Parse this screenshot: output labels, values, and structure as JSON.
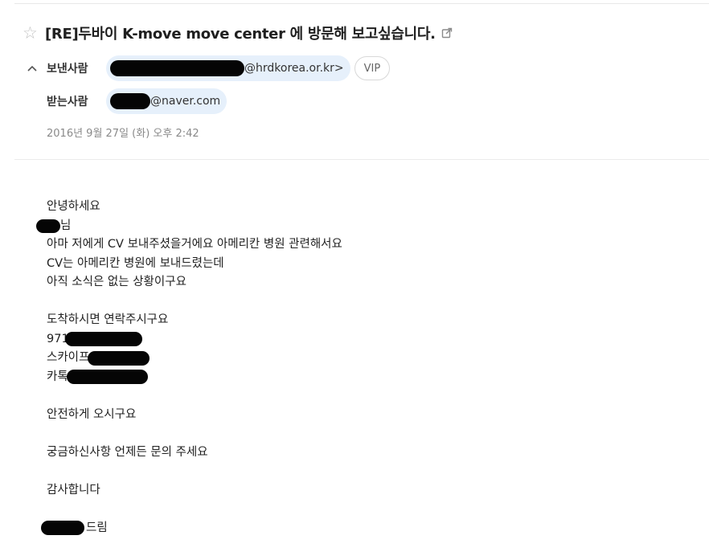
{
  "email": {
    "subject": "[RE]두바이 K-move move center 에 방문해 보고싶습니다.",
    "from_label": "보낸사람",
    "from_domain": "@hrdkorea.or.kr>",
    "vip_label": "VIP",
    "to_label": "받는사람",
    "to_domain": "@naver.com",
    "date": "2016년 9월 27일 (화) 오후 2:42"
  },
  "body": {
    "greeting": "안녕하세요",
    "name_suffix": "님",
    "line1": "아마 저에게 CV 보내주셨을거에요 아메리칸 병원 관련해서요",
    "line2": "CV는 아메리칸 병원에 보내드렸는데",
    "line3": "아직 소식은 없는 상황이구요",
    "line4": "도착하시면 연락주시구요",
    "phone_prefix": "971",
    "skype_label": "스카이프",
    "kakao_label": "카톡",
    "line5": "안전하게 오시구요",
    "line6": "궁금하신사항 언제든 문의 주세요",
    "line7": "감사합니다",
    "closing": "드림"
  },
  "icons": {
    "star": "star-outline-icon",
    "popout": "external-window-icon",
    "collapse": "chevron-up-icon"
  }
}
